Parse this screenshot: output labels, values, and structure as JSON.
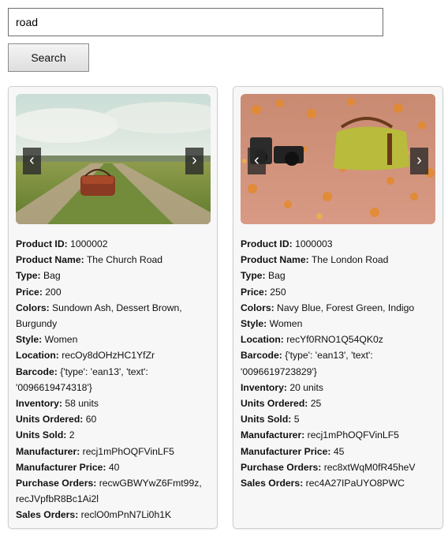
{
  "search": {
    "value": "road",
    "button_label": "Search"
  },
  "products": [
    {
      "fields": [
        {
          "label": "Product ID:",
          "value": "1000002"
        },
        {
          "label": "Product Name:",
          "value": "The Church Road"
        },
        {
          "label": "Type:",
          "value": "Bag"
        },
        {
          "label": "Price:",
          "value": "200"
        },
        {
          "label": "Colors:",
          "value": "Sundown Ash, Dessert Brown, Burgundy"
        },
        {
          "label": "Style:",
          "value": "Women"
        },
        {
          "label": "Location:",
          "value": "recOy8dOHzHC1YfZr"
        },
        {
          "label": "Barcode:",
          "value": "{'type': 'ean13', 'text': '0096619474318'}"
        },
        {
          "label": "Inventory:",
          "value": "58 units"
        },
        {
          "label": "Units Ordered:",
          "value": "60"
        },
        {
          "label": "Units Sold:",
          "value": "2"
        },
        {
          "label": "Manufacturer:",
          "value": "recj1mPhOQFVinLF5"
        },
        {
          "label": "Manufacturer Price:",
          "value": "40"
        },
        {
          "label": "Purchase Orders:",
          "value": "recwGBWYwZ6Fmt99z, recJVpfbR8Bc1Ai2l"
        },
        {
          "label": "Sales Orders:",
          "value": "reclO0mPnN7Li0h1K"
        }
      ],
      "prev_glyph": "‹",
      "next_glyph": "›"
    },
    {
      "fields": [
        {
          "label": "Product ID:",
          "value": "1000003"
        },
        {
          "label": "Product Name:",
          "value": "The London Road"
        },
        {
          "label": "Type:",
          "value": "Bag"
        },
        {
          "label": "Price:",
          "value": "250"
        },
        {
          "label": "Colors:",
          "value": "Navy Blue, Forest Green, Indigo"
        },
        {
          "label": "Style:",
          "value": "Women"
        },
        {
          "label": "Location:",
          "value": "recYf0RNO1Q54QK0z"
        },
        {
          "label": "Barcode:",
          "value": "{'type': 'ean13', 'text': '0096619723829'}"
        },
        {
          "label": "Inventory:",
          "value": "20 units"
        },
        {
          "label": "Units Ordered:",
          "value": "25"
        },
        {
          "label": "Units Sold:",
          "value": "5"
        },
        {
          "label": "Manufacturer:",
          "value": "recj1mPhOQFVinLF5"
        },
        {
          "label": "Manufacturer Price:",
          "value": "45"
        },
        {
          "label": "Purchase Orders:",
          "value": "rec8xtWqM0fR45heV"
        },
        {
          "label": "Sales Orders:",
          "value": "rec4A27IPaUYO8PWC"
        }
      ],
      "prev_glyph": "‹",
      "next_glyph": "›"
    }
  ]
}
